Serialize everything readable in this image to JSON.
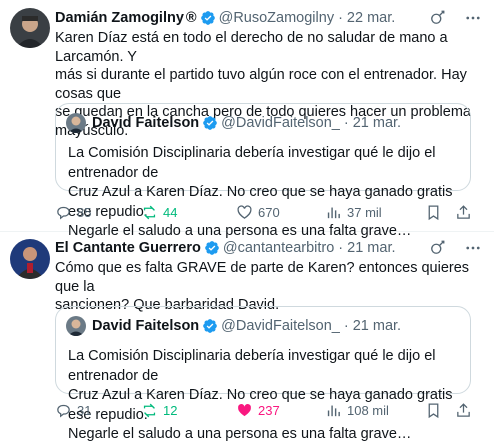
{
  "tweets": [
    {
      "author_name": "Damián Zamogilny",
      "author_suffix": "®",
      "handle": "@RusoZamogilny",
      "separator": "·",
      "date": "22 mar.",
      "text_lines": [
        "Karen Díaz está en todo el derecho de no saludar de mano a Larcamón. Y",
        "más si durante el partido tuvo algún roce con el entrenador. Hay cosas que",
        "se quedan en la cancha pero de todo quieres hacer un problema",
        "mayúsculo."
      ],
      "quote": {
        "author_name": "David Faitelson",
        "handle": "@DavidFaitelson_",
        "separator": "·",
        "date": "21 mar.",
        "text_lines": [
          "La Comisión Disciplinaria debería investigar qué le dijo el entrenador de",
          "Cruz Azul a Karen Díaz. No creo que se haya ganado gratis ese repudio.",
          "Negarle el saludo a una persona es una falta grave…"
        ]
      },
      "replies": "85",
      "reposts": "44",
      "likes": "670",
      "views": "37 mil"
    },
    {
      "author_name": "El Cantante Guerrero",
      "handle": "@cantantearbitro",
      "separator": "·",
      "date": "21 mar.",
      "text_lines": [
        "Cómo que es falta GRAVE de parte de Karen? entonces quieres que la",
        "sancionen? Que barbaridad David."
      ],
      "quote": {
        "author_name": "David Faitelson",
        "handle": "@DavidFaitelson_",
        "separator": "·",
        "date": "21 mar.",
        "text_lines": [
          "La Comisión Disciplinaria debería investigar qué le dijo el entrenador de",
          "Cruz Azul a Karen Díaz. No creo que se haya ganado gratis ese repudio.",
          "Negarle el saludo a una persona es una falta grave…"
        ]
      },
      "replies": "31",
      "reposts": "12",
      "likes": "237",
      "views": "108 mil"
    }
  ],
  "colors": {
    "verified": "#1d9bf0",
    "text": "#0f1419",
    "muted": "#536471",
    "repost": "#00ba7c",
    "liked": "#f91880",
    "border": "#cfd9de"
  },
  "icons": [
    "verified-badge-icon",
    "grok-icon",
    "more-icon",
    "reply-icon",
    "repost-icon",
    "like-icon",
    "views-icon",
    "bookmark-icon",
    "share-icon"
  ]
}
